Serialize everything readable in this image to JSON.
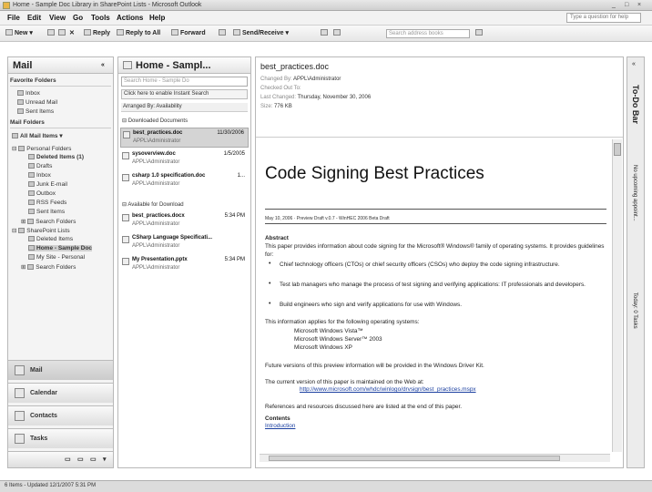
{
  "window": {
    "title": "Home - Sample Doc Library in SharePoint Lists - Microsoft Outlook",
    "controls": [
      "_",
      "□",
      "×"
    ]
  },
  "menu": {
    "items": [
      "File",
      "Edit",
      "View",
      "Go",
      "Tools",
      "Actions",
      "Help"
    ],
    "ask_placeholder": "Type a question for help"
  },
  "toolbar": {
    "new": "New",
    "print": "",
    "reply": "Reply",
    "reply_all": "Reply to All",
    "forward": "Forward",
    "send_receive": "Send/Receive",
    "search_placeholder": "Search address books"
  },
  "nav": {
    "title": "Mail",
    "favorites_header": "Favorite Folders",
    "favorites": [
      "Inbox",
      "Unread Mail",
      "Sent Items"
    ],
    "mail_folders_header": "Mail Folders",
    "all_items": "All Mail Items",
    "tree": [
      "Personal Folders",
      "Deleted Items (1)",
      "Drafts",
      "Inbox",
      "Junk E-mail",
      "Outbox",
      "RSS Feeds",
      "Sent Items",
      "Search Folders",
      "SharePoint Lists",
      "Deleted Items",
      "Home - Sample Doc",
      "My Site - Personal",
      "Search Folders"
    ],
    "buttons": [
      "Mail",
      "Calendar",
      "Contacts",
      "Tasks"
    ]
  },
  "list": {
    "title": "Home - Sampl...",
    "search_placeholder": "Search Home - Sample Do",
    "instant_search": "Click here to enable Instant Search",
    "arranged_by": "Arranged By: Availability",
    "group1": "Downloaded Documents",
    "group2": "Available for Download",
    "messages": [
      {
        "name": "best_practices.doc",
        "date": "11/30/2006",
        "sub": "APPL\\Administrator"
      },
      {
        "name": "sysoverview.doc",
        "date": "1/5/2005",
        "sub": "APPL\\Administrator"
      },
      {
        "name": "csharp 1.0 specification.doc",
        "date": "1...",
        "sub": "APPL\\Administrator"
      },
      {
        "name": "best_practices.docx",
        "date": "5:34 PM",
        "sub": "APPL\\Administrator"
      },
      {
        "name": "CSharp Language Specificati...",
        "date": "",
        "sub": "APPL\\Administrator"
      },
      {
        "name": "My Presentation.pptx",
        "date": "5:34 PM",
        "sub": "APPL\\Administrator"
      }
    ]
  },
  "reading": {
    "subject": "best_practices.doc",
    "changed_by_label": "Changed By:",
    "changed_by": "APPL\\Administrator",
    "checked_out": "Checked Out To:",
    "last_changed_label": "Last Changed:",
    "last_changed": "Thursday, November 30, 2006",
    "size_label": "Size:",
    "size": "776 KB",
    "doc_title": "Code Signing Best Practices",
    "doc_date": "May 10, 2006 · Preview Draft v.0.7 - WinHEC 2006 Beta Draft",
    "abstract_head": "Abstract",
    "abstract": "This paper provides information about code signing for the Microsoft® Windows® family of operating systems. It provides guidelines for:",
    "bullets": [
      "Chief technology officers (CTOs) or chief security officers (CSOs) who deploy the code signing infrastructure.",
      "Test lab managers who manage the process of test signing and verifying applications: IT professionals and developers.",
      "Build engineers who sign and verify applications for use with Windows."
    ],
    "applies": "This information applies for the following operating systems:",
    "os": [
      "Microsoft Windows Vista™",
      "Microsoft Windows Server™ 2003",
      "Microsoft Windows XP"
    ],
    "future": "Future versions of this preview information will be provided in the Windows Driver Kit.",
    "current": "The current version of this paper is maintained on the Web at:",
    "link": "http://www.microsoft.com/whdc/winlogo/drvsign/best_practices.mspx",
    "refs": "References and resources discussed here are listed at the end of this paper.",
    "contents": "Contents",
    "intro": "Introduction"
  },
  "todo": {
    "title": "To-Do Bar",
    "no_appt": "No upcoming appoint...",
    "tasks": "Today: 0 Tasks"
  },
  "status": {
    "text": "6 Items - Updated 12/1/2007 5:31 PM"
  }
}
